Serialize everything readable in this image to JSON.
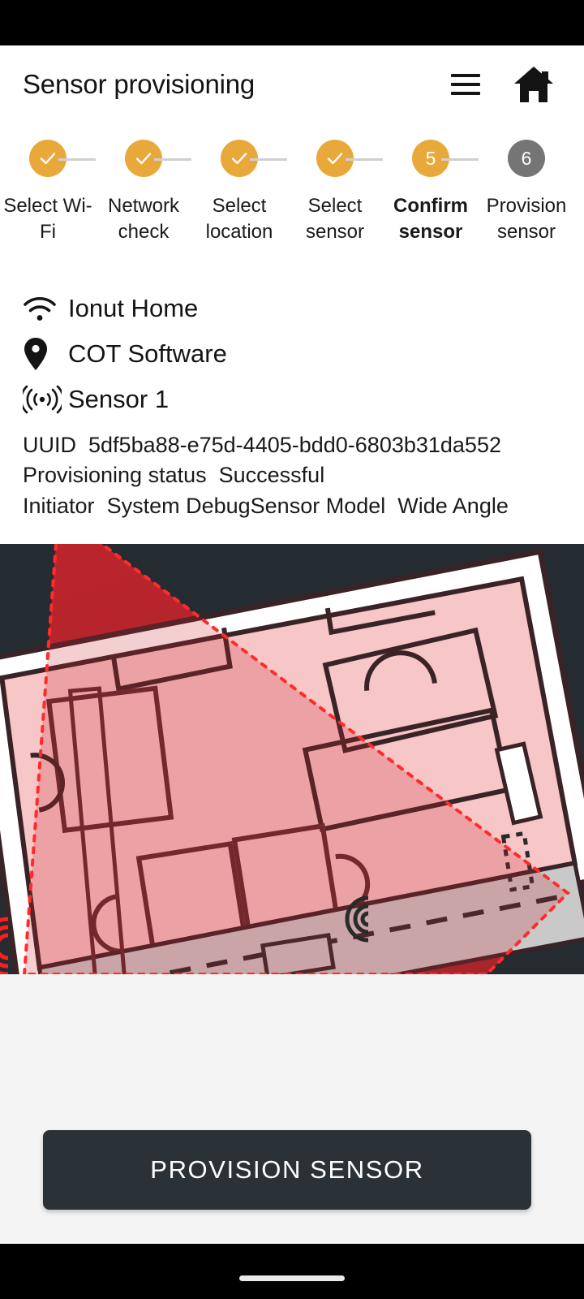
{
  "appbar": {
    "title": "Sensor provisioning",
    "menu_icon": "hamburger-menu-icon",
    "home_icon": "home-icon"
  },
  "stepper": {
    "steps": [
      {
        "index": "1",
        "label": "Select Wi-Fi",
        "state": "done"
      },
      {
        "index": "2",
        "label": "Network check",
        "state": "done"
      },
      {
        "index": "3",
        "label": "Select location",
        "state": "done"
      },
      {
        "index": "4",
        "label": "Select sensor",
        "state": "done"
      },
      {
        "index": "5",
        "label": "Confirm sensor",
        "state": "active"
      },
      {
        "index": "6",
        "label": "Provision sensor",
        "state": "todo"
      }
    ],
    "colors": {
      "done": "#E9A93A",
      "active": "#E9A93A",
      "todo": "#757575",
      "connector": "#CFCFCF"
    }
  },
  "summary": {
    "wifi": {
      "icon": "wifi-icon",
      "value": "Ionut Home"
    },
    "location": {
      "icon": "map-pin-icon",
      "value": "COT Software"
    },
    "sensor": {
      "icon": "sensor-waves-icon",
      "value": "Sensor 1"
    }
  },
  "details": {
    "uuid_label": "UUID",
    "uuid_value": "5df5ba88-e75d-4405-bdd0-6803b31da552",
    "status_label": "Provisioning status",
    "status_value": "Successful",
    "initiator_label": "Initiator",
    "initiator_value": "System Debug",
    "model_label": "Sensor Model",
    "model_value": "Wide Angle"
  },
  "preview": {
    "name": "floorplan-coverage-preview",
    "background_color": "#242B31",
    "coverage_color": "#D8323A",
    "floor_color": "#F7C6C6"
  },
  "action": {
    "label": "PROVISION SENSOR",
    "background": "#2B3237"
  }
}
